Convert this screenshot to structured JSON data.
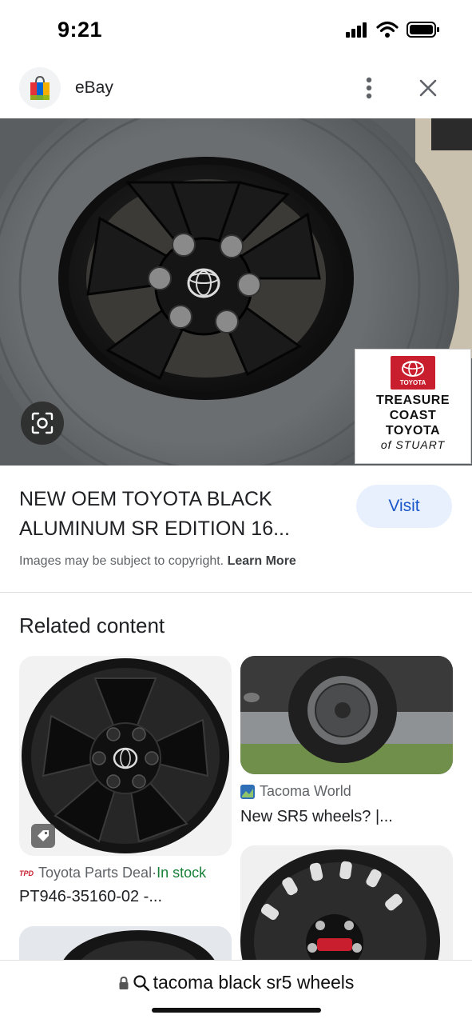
{
  "status_bar": {
    "time": "9:21",
    "icons": [
      "cellular-signal-icon",
      "wifi-icon",
      "battery-icon"
    ]
  },
  "header": {
    "site_name": "eBay",
    "logo_icon": "shopping-bag-icon",
    "more_icon": "more-vertical-icon",
    "close_icon": "close-icon"
  },
  "hero": {
    "lens_icon": "lens-search-icon",
    "dealer_badge": {
      "brand": "TOYOTA",
      "lines": [
        "TREASURE",
        "COAST",
        "TOYOTA"
      ],
      "sub": "of STUART"
    }
  },
  "result": {
    "title": "NEW OEM TOYOTA BLACK ALUMINUM SR EDITION 16...",
    "visit_label": "Visit",
    "copyright_text": "Images may be subject to copyright.",
    "learn_more": "Learn More"
  },
  "related": {
    "heading": "Related content",
    "cards": [
      {
        "source": "Toyota Parts Deal",
        "separator": " · ",
        "availability": "In stock",
        "title": "PT946-35160-02 -..."
      },
      {
        "source": "Tacoma World",
        "title": "New SR5 wheels? |..."
      }
    ]
  },
  "bottom_bar": {
    "url": "tacoma black sr5 wheels",
    "lock_icon": "lock-icon",
    "search_icon": "search-icon"
  },
  "colors": {
    "accent": "#1a57c9",
    "visit_bg": "#e8f0fe",
    "in_stock": "#188038",
    "toyota_red": "#c81e2d"
  }
}
